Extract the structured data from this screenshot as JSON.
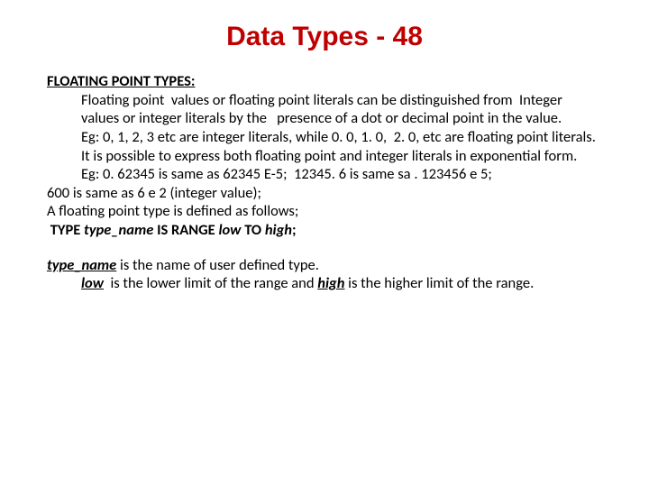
{
  "title": "Data Types - 48",
  "heading": "FLOATING POINT TYPES:",
  "p1a": "Floating point  values or floating point literals can be distinguished from  Integer values or integer literals by the   presence of a dot or decimal point in the value.",
  "p2": "Eg: 0, 1, 2, 3 etc are integer literals, while 0. 0, 1. 0,  2. 0, etc are floating point literals.",
  "p3": "It is possible to express both floating point and integer literals in exponential form.",
  "p4": "Eg: 0. 62345 is same as 62345 E-5;  12345. 6 is same sa . 123456 e 5;",
  "p5": "600 is same as 6 e 2 (integer value);",
  "p6": "A floating point type is defined as follows;",
  "syntax_pre": " ",
  "syntax_type": "TYPE",
  "syntax_typename": "type_name",
  "syntax_isrange": "IS RANGE",
  "syntax_low": "low",
  "syntax_to": "TO",
  "syntax_high": "high",
  "syntax_semi": ";",
  "desc_typename": "type_name",
  "desc_type_after": " is the name of user defined type.",
  "desc_low": "low",
  "desc_low_after": "  is the lower limit of the range and ",
  "desc_high": "high",
  "desc_high_after": " is the higher limit of the range."
}
